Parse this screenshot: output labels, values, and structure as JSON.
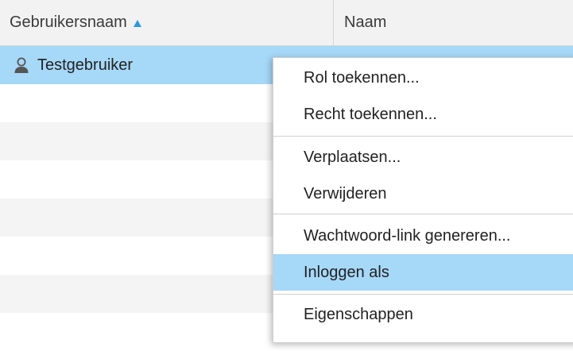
{
  "table": {
    "columns": [
      {
        "label": "Gebruikersnaam",
        "sort": "ascending"
      },
      {
        "label": "Naam"
      }
    ],
    "rows": [
      {
        "username": "Testgebruiker",
        "name": "",
        "selected": true
      }
    ]
  },
  "context_menu": {
    "groups": [
      [
        "Rol toekennen...",
        "Recht toekennen..."
      ],
      [
        "Verplaatsen...",
        "Verwijderen"
      ],
      [
        "Wachtwoord-link genereren...",
        "Inloggen als"
      ],
      [
        "Eigenschappen"
      ]
    ],
    "items": {
      "assign_role": "Rol toekennen...",
      "assign_right": "Recht toekennen...",
      "move": "Verplaatsen...",
      "delete": "Verwijderen",
      "password_link": "Wachtwoord-link genereren...",
      "login_as": "Inloggen als",
      "properties": "Eigenschappen"
    },
    "highlighted": "Inloggen als"
  },
  "colors": {
    "selection": "#a6d8f8",
    "sort_indicator": "#2b9be0",
    "header_bg": "#f2f2f2",
    "alt_row": "#f4f4f4"
  },
  "icons": {
    "user": "user-icon",
    "sort": "sort-asc-icon"
  }
}
